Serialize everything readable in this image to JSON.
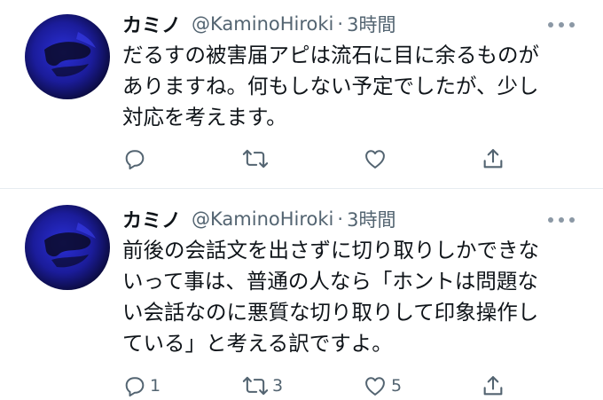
{
  "tweets": [
    {
      "author": {
        "name": "カミノ",
        "handle": "@KaminoHiroki",
        "separator": "·",
        "time": "3時間"
      },
      "lines": [
        "だるすの被害届アピは流石に目に余るものが",
        "ありますね。何もしない予定でしたが、少し",
        "対応を考えます。"
      ],
      "actions": {
        "reply": {
          "icon": "reply-icon",
          "count": ""
        },
        "retweet": {
          "icon": "retweet-icon",
          "count": ""
        },
        "like": {
          "icon": "heart-icon",
          "count": ""
        },
        "share": {
          "icon": "share-icon",
          "count": ""
        }
      }
    },
    {
      "author": {
        "name": "カミノ",
        "handle": "@KaminoHiroki",
        "separator": "·",
        "time": "3時間"
      },
      "lines": [
        "前後の会話文を出さずに切り取りしかできな",
        "いって事は、普通の人なら「ホントは問題な",
        "い会話なのに悪質な切り取りして印象操作し",
        "ている」と考える訳ですよ。"
      ],
      "actions": {
        "reply": {
          "icon": "reply-icon",
          "count": "1"
        },
        "retweet": {
          "icon": "retweet-icon",
          "count": "3"
        },
        "like": {
          "icon": "heart-icon",
          "count": "5"
        },
        "share": {
          "icon": "share-icon",
          "count": ""
        }
      }
    }
  ],
  "colors": {
    "text": "#0f1419",
    "secondary": "#536471",
    "icon": "#536471",
    "divider": "#e6ecf0"
  }
}
